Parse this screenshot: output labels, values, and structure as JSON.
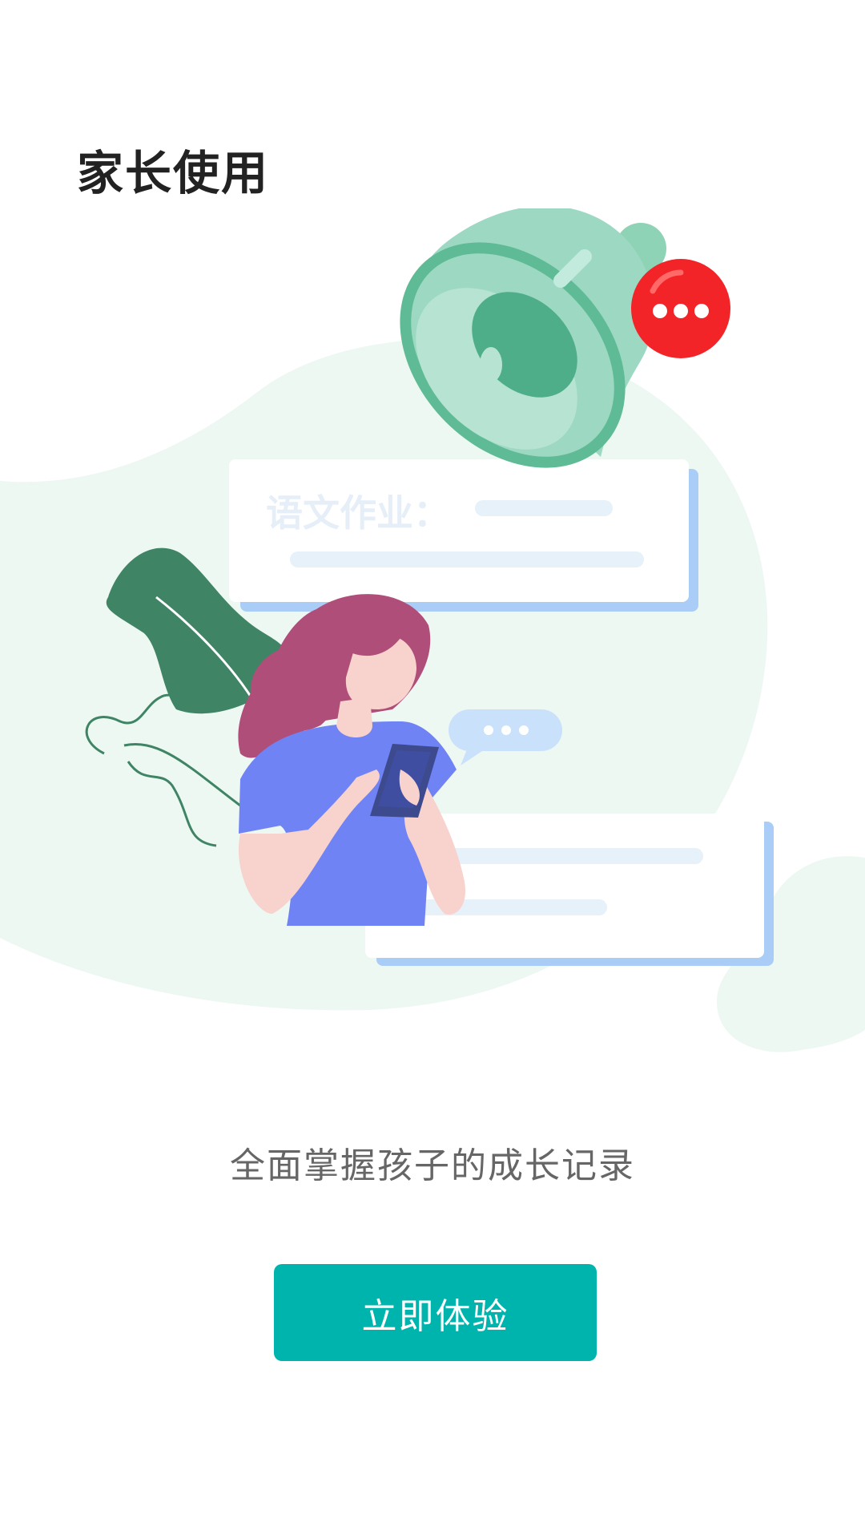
{
  "header": {
    "title": "家长使用"
  },
  "illustration": {
    "card_label": "语文作业：",
    "theme_colors": {
      "blob": "#edf8f2",
      "bell": "#9dd8c3",
      "badge": "#f32428",
      "person_shirt": "#7083f5",
      "hair": "#b04e7a",
      "leaf": "#408466",
      "card_shadow": "#a9cdf6"
    }
  },
  "main": {
    "subtitle": "全面掌握孩子的成长记录",
    "cta_label": "立即体验"
  },
  "colors": {
    "accent": "#00b4ae",
    "title_text": "#222222",
    "subtitle_text": "#666666"
  }
}
